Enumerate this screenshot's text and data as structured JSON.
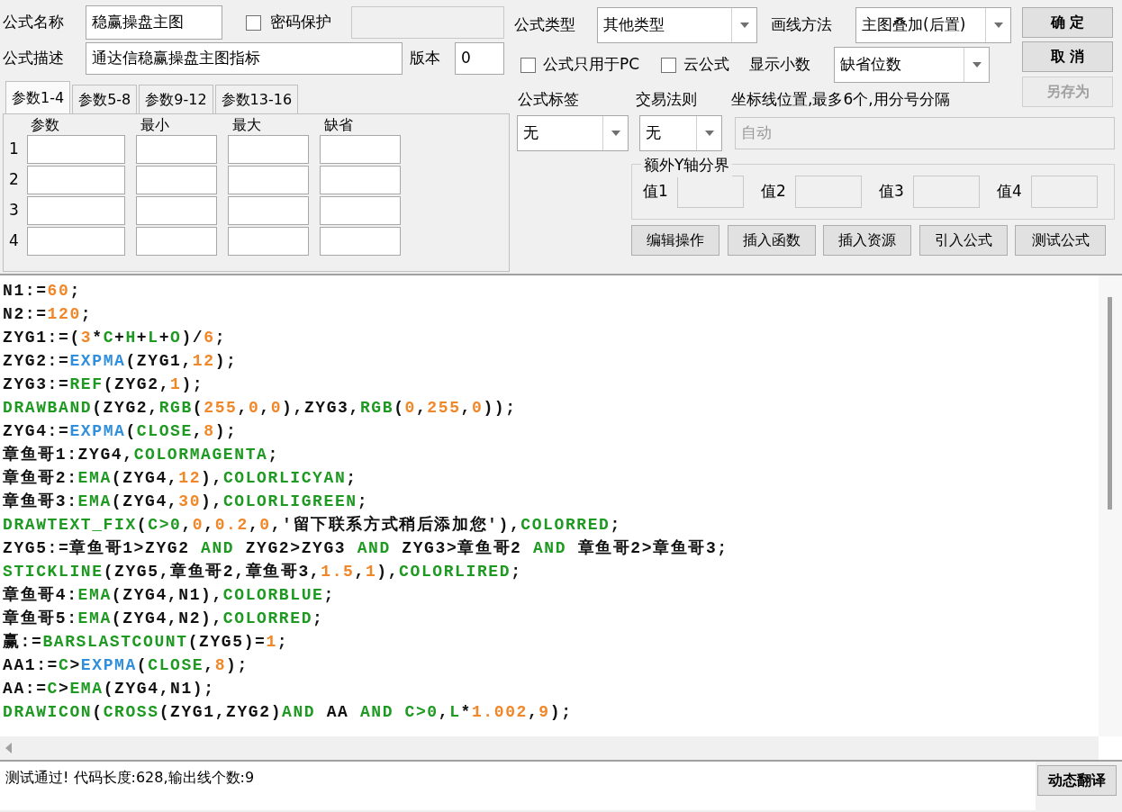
{
  "formula": {
    "name_label": "公式名称",
    "name": "稳赢操盘主图",
    "password": {
      "label": "密码保护",
      "checked": false,
      "field_disabled": true
    },
    "desc_label": "公式描述",
    "description": "通达信稳赢操盘主图指标",
    "version_label": "版本",
    "version": "0"
  },
  "param_tabs": [
    {
      "label": "参数1-4",
      "selected": true
    },
    {
      "label": "参数5-8",
      "selected": false
    },
    {
      "label": "参数9-12",
      "selected": false
    },
    {
      "label": "参数13-16",
      "selected": false
    }
  ],
  "param_columns": [
    "参数",
    "最小",
    "最大",
    "缺省"
  ],
  "param_rows": [
    "1",
    "2",
    "3",
    "4"
  ],
  "type": {
    "label": "公式类型",
    "value": "其他类型"
  },
  "draw_method": {
    "label": "画线方法",
    "value": "主图叠加(后置)"
  },
  "options": [
    {
      "label": "公式只用于PC",
      "checked": false
    },
    {
      "label": "云公式",
      "checked": false
    }
  ],
  "decimals": {
    "label": "显示小数",
    "value": "缺省位数"
  },
  "side_buttons": [
    {
      "label": "确 定",
      "disabled": false
    },
    {
      "label": "取 消",
      "disabled": false
    },
    {
      "label": "另存为",
      "disabled": true
    }
  ],
  "tag": {
    "label": "公式标签",
    "value": "无"
  },
  "trade_rule": {
    "label": "交易法则",
    "value": "无"
  },
  "axis_lines": {
    "label": "坐标线位置,最多6个,用分号分隔",
    "value": "自动",
    "disabled": true
  },
  "y_bounds": {
    "title": "额外Y轴分界",
    "fields": [
      "值1",
      "值2",
      "值3",
      "值4"
    ]
  },
  "tool_buttons": [
    "编辑操作",
    "插入函数",
    "插入资源",
    "引入公式",
    "测试公式"
  ],
  "code_lines": [
    [
      {
        "kind": "plain",
        "text": "N1:="
      },
      {
        "kind": "number",
        "text": "60"
      },
      {
        "kind": "plain",
        "text": ";"
      }
    ],
    [
      {
        "kind": "plain",
        "text": "N2:="
      },
      {
        "kind": "number",
        "text": "120"
      },
      {
        "kind": "plain",
        "text": ";"
      }
    ],
    [
      {
        "kind": "plain",
        "text": "ZYG1:=("
      },
      {
        "kind": "number",
        "text": "3"
      },
      {
        "kind": "plain",
        "text": "*"
      },
      {
        "kind": "function",
        "text": "C"
      },
      {
        "kind": "plain",
        "text": "+"
      },
      {
        "kind": "function",
        "text": "H"
      },
      {
        "kind": "plain",
        "text": "+"
      },
      {
        "kind": "function",
        "text": "L"
      },
      {
        "kind": "plain",
        "text": "+"
      },
      {
        "kind": "function",
        "text": "O"
      },
      {
        "kind": "plain",
        "text": ")/"
      },
      {
        "kind": "number",
        "text": "6"
      },
      {
        "kind": "plain",
        "text": ";"
      }
    ],
    [
      {
        "kind": "plain",
        "text": "ZYG2:="
      },
      {
        "kind": "builtin",
        "text": "EXPMA"
      },
      {
        "kind": "plain",
        "text": "(ZYG1,"
      },
      {
        "kind": "number",
        "text": "12"
      },
      {
        "kind": "plain",
        "text": ");"
      }
    ],
    [
      {
        "kind": "plain",
        "text": "ZYG3:="
      },
      {
        "kind": "function",
        "text": "REF"
      },
      {
        "kind": "plain",
        "text": "(ZYG2,"
      },
      {
        "kind": "number",
        "text": "1"
      },
      {
        "kind": "plain",
        "text": ");"
      }
    ],
    [
      {
        "kind": "function",
        "text": "DRAWBAND"
      },
      {
        "kind": "plain",
        "text": "(ZYG2,"
      },
      {
        "kind": "function",
        "text": "RGB"
      },
      {
        "kind": "plain",
        "text": "("
      },
      {
        "kind": "number",
        "text": "255"
      },
      {
        "kind": "plain",
        "text": ","
      },
      {
        "kind": "number",
        "text": "0"
      },
      {
        "kind": "plain",
        "text": ","
      },
      {
        "kind": "number",
        "text": "0"
      },
      {
        "kind": "plain",
        "text": "),ZYG3,"
      },
      {
        "kind": "function",
        "text": "RGB"
      },
      {
        "kind": "plain",
        "text": "("
      },
      {
        "kind": "number",
        "text": "0"
      },
      {
        "kind": "plain",
        "text": ","
      },
      {
        "kind": "number",
        "text": "255"
      },
      {
        "kind": "plain",
        "text": ","
      },
      {
        "kind": "number",
        "text": "0"
      },
      {
        "kind": "plain",
        "text": "));"
      }
    ],
    [
      {
        "kind": "plain",
        "text": "ZYG4:="
      },
      {
        "kind": "builtin",
        "text": "EXPMA"
      },
      {
        "kind": "plain",
        "text": "("
      },
      {
        "kind": "function",
        "text": "CLOSE"
      },
      {
        "kind": "plain",
        "text": ","
      },
      {
        "kind": "number",
        "text": "8"
      },
      {
        "kind": "plain",
        "text": ");"
      }
    ],
    [
      {
        "kind": "plain",
        "text": "章鱼哥1:ZYG4,"
      },
      {
        "kind": "function",
        "text": "COLORMAGENTA"
      },
      {
        "kind": "plain",
        "text": ";"
      }
    ],
    [
      {
        "kind": "plain",
        "text": "章鱼哥2:"
      },
      {
        "kind": "function",
        "text": "EMA"
      },
      {
        "kind": "plain",
        "text": "(ZYG4,"
      },
      {
        "kind": "number",
        "text": "12"
      },
      {
        "kind": "plain",
        "text": "),"
      },
      {
        "kind": "function",
        "text": "COLORLICYAN"
      },
      {
        "kind": "plain",
        "text": ";"
      }
    ],
    [
      {
        "kind": "plain",
        "text": "章鱼哥3:"
      },
      {
        "kind": "function",
        "text": "EMA"
      },
      {
        "kind": "plain",
        "text": "(ZYG4,"
      },
      {
        "kind": "number",
        "text": "30"
      },
      {
        "kind": "plain",
        "text": "),"
      },
      {
        "kind": "function",
        "text": "COLORLIGREEN"
      },
      {
        "kind": "plain",
        "text": ";"
      }
    ],
    [
      {
        "kind": "function",
        "text": "DRAWTEXT_FIX"
      },
      {
        "kind": "plain",
        "text": "("
      },
      {
        "kind": "function",
        "text": "C>0"
      },
      {
        "kind": "plain",
        "text": ","
      },
      {
        "kind": "number",
        "text": "0"
      },
      {
        "kind": "plain",
        "text": ","
      },
      {
        "kind": "number",
        "text": "0.2"
      },
      {
        "kind": "plain",
        "text": ","
      },
      {
        "kind": "number",
        "text": "0"
      },
      {
        "kind": "plain",
        "text": ",'留下联系方式稍后添加您'),"
      },
      {
        "kind": "function",
        "text": "COLORRED"
      },
      {
        "kind": "plain",
        "text": ";"
      }
    ],
    [
      {
        "kind": "plain",
        "text": "ZYG5:=章鱼哥1>ZYG2 "
      },
      {
        "kind": "function",
        "text": "AND"
      },
      {
        "kind": "plain",
        "text": " ZYG2>ZYG3 "
      },
      {
        "kind": "function",
        "text": "AND"
      },
      {
        "kind": "plain",
        "text": " ZYG3>章鱼哥2 "
      },
      {
        "kind": "function",
        "text": "AND"
      },
      {
        "kind": "plain",
        "text": " 章鱼哥2>章鱼哥3;"
      }
    ],
    [
      {
        "kind": "function",
        "text": "STICKLINE"
      },
      {
        "kind": "plain",
        "text": "(ZYG5,章鱼哥2,章鱼哥3,"
      },
      {
        "kind": "number",
        "text": "1.5"
      },
      {
        "kind": "plain",
        "text": ","
      },
      {
        "kind": "number",
        "text": "1"
      },
      {
        "kind": "plain",
        "text": "),"
      },
      {
        "kind": "function",
        "text": "COLORLIRED"
      },
      {
        "kind": "plain",
        "text": ";"
      }
    ],
    [
      {
        "kind": "plain",
        "text": "章鱼哥4:"
      },
      {
        "kind": "function",
        "text": "EMA"
      },
      {
        "kind": "plain",
        "text": "(ZYG4,N1),"
      },
      {
        "kind": "function",
        "text": "COLORBLUE"
      },
      {
        "kind": "plain",
        "text": ";"
      }
    ],
    [
      {
        "kind": "plain",
        "text": "章鱼哥5:"
      },
      {
        "kind": "function",
        "text": "EMA"
      },
      {
        "kind": "plain",
        "text": "(ZYG4,N2),"
      },
      {
        "kind": "function",
        "text": "COLORRED"
      },
      {
        "kind": "plain",
        "text": ";"
      }
    ],
    [
      {
        "kind": "plain",
        "text": "赢:="
      },
      {
        "kind": "function",
        "text": "BARSLASTCOUNT"
      },
      {
        "kind": "plain",
        "text": "(ZYG5)="
      },
      {
        "kind": "number",
        "text": "1"
      },
      {
        "kind": "plain",
        "text": ";"
      }
    ],
    [
      {
        "kind": "plain",
        "text": "AA1:="
      },
      {
        "kind": "function",
        "text": "C"
      },
      {
        "kind": "plain",
        "text": ">"
      },
      {
        "kind": "builtin",
        "text": "EXPMA"
      },
      {
        "kind": "plain",
        "text": "("
      },
      {
        "kind": "function",
        "text": "CLOSE"
      },
      {
        "kind": "plain",
        "text": ","
      },
      {
        "kind": "number",
        "text": "8"
      },
      {
        "kind": "plain",
        "text": ");"
      }
    ],
    [
      {
        "kind": "plain",
        "text": "AA:="
      },
      {
        "kind": "function",
        "text": "C"
      },
      {
        "kind": "plain",
        "text": ">"
      },
      {
        "kind": "function",
        "text": "EMA"
      },
      {
        "kind": "plain",
        "text": "(ZYG4,N1);"
      }
    ],
    [
      {
        "kind": "function",
        "text": "DRAWICON"
      },
      {
        "kind": "plain",
        "text": "("
      },
      {
        "kind": "function",
        "text": "CROSS"
      },
      {
        "kind": "plain",
        "text": "(ZYG1,ZYG2)"
      },
      {
        "kind": "function",
        "text": "AND"
      },
      {
        "kind": "plain",
        "text": " AA "
      },
      {
        "kind": "function",
        "text": "AND"
      },
      {
        "kind": "function",
        "text": " C>0"
      },
      {
        "kind": "plain",
        "text": ","
      },
      {
        "kind": "function",
        "text": "L"
      },
      {
        "kind": "plain",
        "text": "*"
      },
      {
        "kind": "number",
        "text": "1.002"
      },
      {
        "kind": "plain",
        "text": ","
      },
      {
        "kind": "number",
        "text": "9"
      },
      {
        "kind": "plain",
        "text": ");"
      }
    ]
  ],
  "status": "测试通过! 代码长度:628,输出线个数:9",
  "translate_button": "动态翻译"
}
